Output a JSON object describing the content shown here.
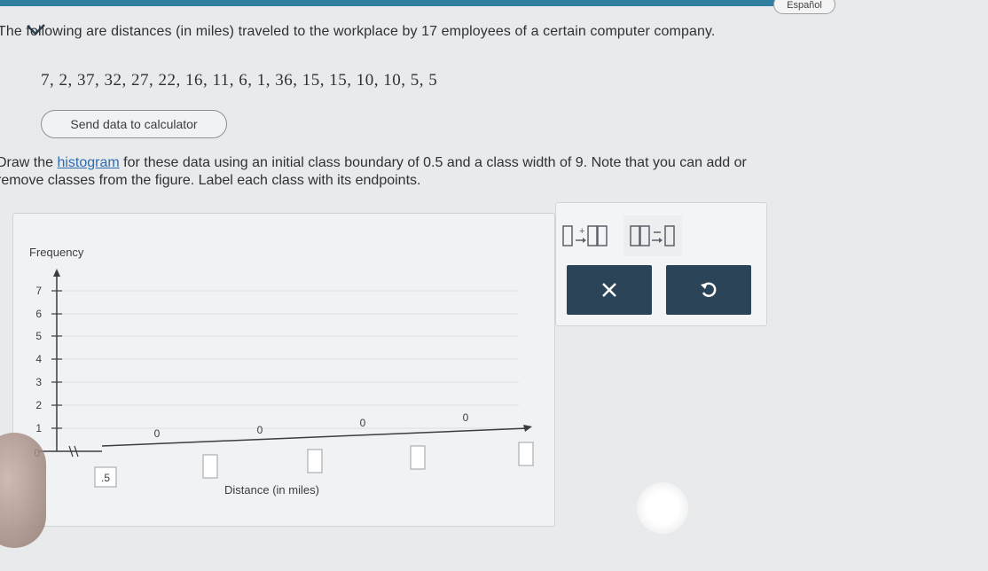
{
  "header": {
    "language_button": "Español"
  },
  "problem": {
    "intro": "The following are distances (in miles) traveled to the workplace by 17 employees of a certain computer company.",
    "data": "7, 2, 37, 32, 27, 22, 16, 11, 6, 1, 36, 15, 15, 10, 10, 5, 5",
    "send_button": "Send data to calculator",
    "instruction_part1": "Draw the ",
    "instruction_link": "histogram",
    "instruction_part2": " for these data using an initial class boundary of 0.5 and a class width of 9. Note that you can add or",
    "instruction_line2": "remove classes from the figure. Label each class with its endpoints."
  },
  "graph": {
    "y_axis_title": "Frequency",
    "x_axis_title": "Distance (in miles)",
    "y_ticks": [
      "0",
      "1",
      "2",
      "3",
      "4",
      "5",
      "6",
      "7"
    ],
    "class_frequencies": [
      "0",
      "0",
      "0",
      "0"
    ],
    "first_boundary": ".5"
  },
  "tools": {
    "add_class_label": "add class",
    "remove_class_label": "remove class",
    "delete_icon": "close-icon",
    "undo_icon": "undo-icon"
  }
}
